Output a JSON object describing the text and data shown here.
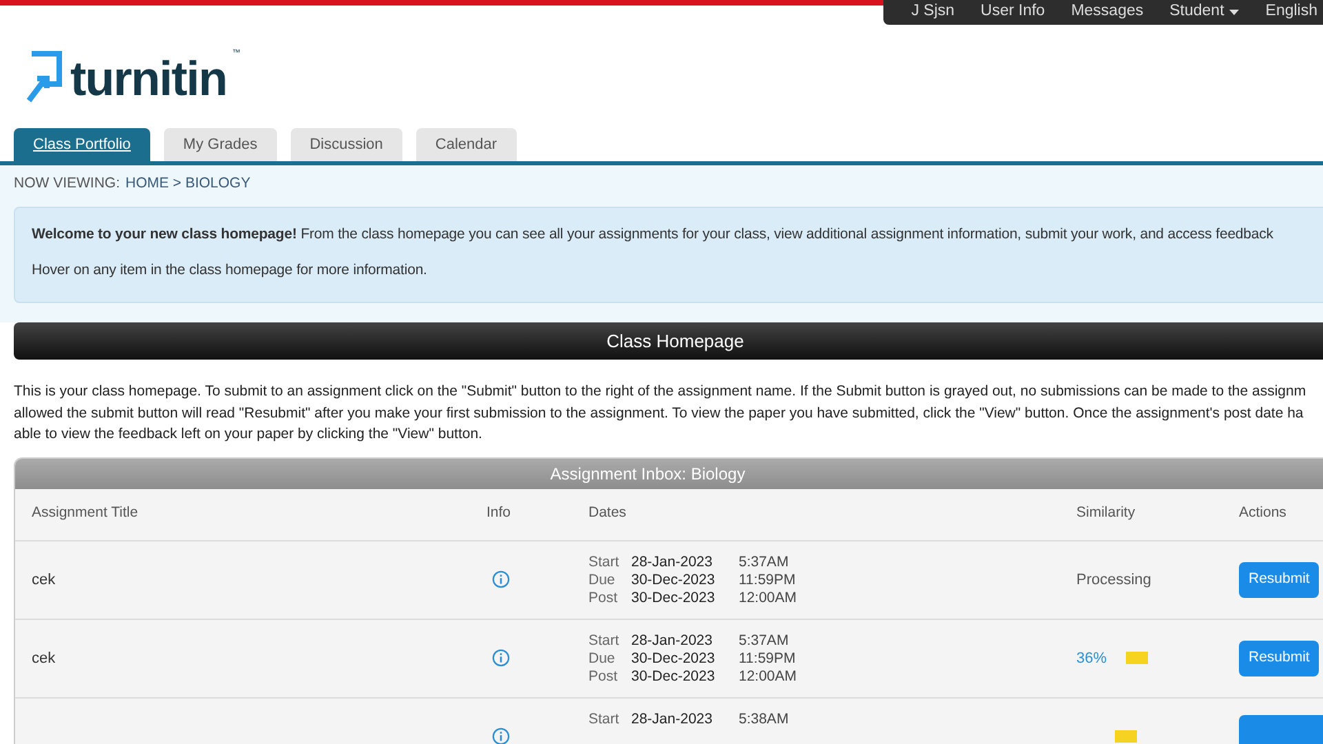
{
  "top_nav": [
    {
      "label": "J Sjsn",
      "dropdown": false
    },
    {
      "label": "User Info",
      "dropdown": false
    },
    {
      "label": "Messages",
      "dropdown": false
    },
    {
      "label": "Student",
      "dropdown": true
    },
    {
      "label": "English",
      "dropdown": false
    }
  ],
  "logo": {
    "text": "turnitin",
    "mark": "™"
  },
  "tabs": [
    {
      "label": "Class Portfolio",
      "selected": true
    },
    {
      "label": "My Grades",
      "selected": false
    },
    {
      "label": "Discussion",
      "selected": false
    },
    {
      "label": "Calendar",
      "selected": false
    }
  ],
  "breadcrumb": {
    "label": "NOW VIEWING:",
    "path": "HOME > BIOLOGY"
  },
  "welcome": {
    "lines": [
      "**Welcome to your new class homepage!** From the class homepage you can see all your assignments for your class, view additional assignment information, submit your work, and access feedback"
    ],
    "hint": "Hover on any item in the class homepage for more information."
  },
  "section_title": "Class Homepage",
  "intro_lines": [
    "This is your class homepage. To submit to an assignment click on the \"Submit\" button to the right of the assignment name. If the Submit button is grayed out, no submissions can be made to the assignm",
    "allowed the submit button will read \"Resubmit\" after you make your first submission to the assignment. To view the paper you have submitted, click the \"View\" button. Once the assignment's post date ha",
    "able to view the feedback left on your paper by clicking the \"View\" button."
  ],
  "inbox": {
    "title": "Assignment Inbox: Biology",
    "columns": [
      "Assignment Title",
      "Info",
      "Dates",
      "Similarity",
      "Actions"
    ],
    "rows": [
      {
        "title": "cek",
        "dates": [
          {
            "label": "Start",
            "date": "28-Jan-2023",
            "time": "5:37AM"
          },
          {
            "label": "Due",
            "date": "30-Dec-2023",
            "time": "11:59PM"
          },
          {
            "label": "Post",
            "date": "30-Dec-2023",
            "time": "12:00AM"
          }
        ],
        "similarity": {
          "kind": "text",
          "text": "Processing"
        },
        "action": "Resubmit"
      },
      {
        "title": "cek",
        "dates": [
          {
            "label": "Start",
            "date": "28-Jan-2023",
            "time": "5:37AM"
          },
          {
            "label": "Due",
            "date": "30-Dec-2023",
            "time": "11:59PM"
          },
          {
            "label": "Post",
            "date": "30-Dec-2023",
            "time": "12:00AM"
          }
        ],
        "similarity": {
          "kind": "score",
          "text": "36%",
          "color": "#f5d320"
        },
        "action": "Resubmit"
      },
      {
        "dates": [
          {
            "label": "Start",
            "date": "28-Jan-2023",
            "time": "5:38AM"
          }
        ],
        "similarity": {
          "kind": "bar",
          "color": "#f5d320"
        }
      }
    ]
  }
}
